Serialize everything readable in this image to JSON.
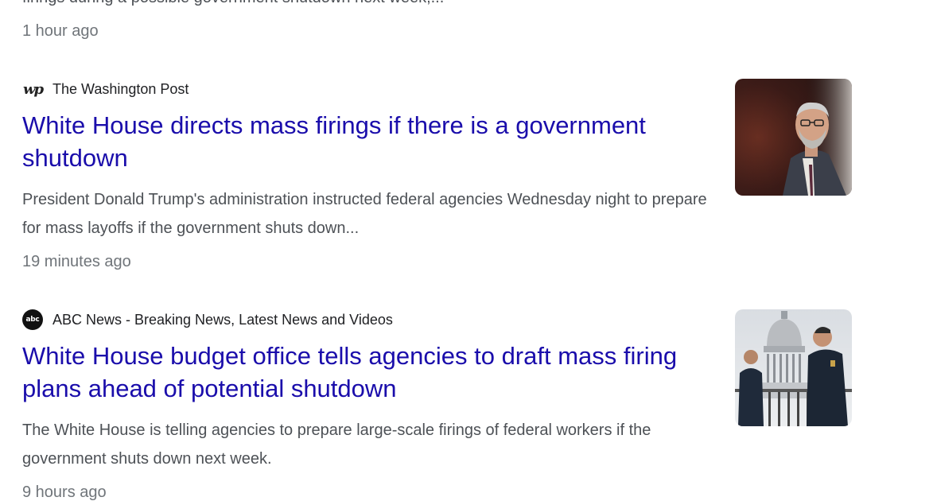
{
  "previous": {
    "snippet": "firings during a possible government shutdown next week,...",
    "time": "1 hour ago"
  },
  "articles": [
    {
      "source": "The Washington Post",
      "logo_text": "wp",
      "logo_icon": "washington-post-logo",
      "title": "White House directs mass firings if there is a government shutdown",
      "snippet": "President Donald Trump's administration instructed federal agencies Wednesday night to prepare for mass layoffs if the government shuts down...",
      "time": "19 minutes ago",
      "thumb_icon": "man-in-suit-photo"
    },
    {
      "source": "ABC News - Breaking News, Latest News and Videos",
      "logo_text": "abc",
      "logo_icon": "abc-news-logo",
      "title": "White House budget office tells agencies to draft mass firing plans ahead of potential shutdown",
      "snippet": "The White House is telling agencies to prepare large-scale firings of federal workers if the government shuts down next week.",
      "time": "9 hours ago",
      "thumb_icon": "capitol-police-photo"
    }
  ],
  "colors": {
    "headline": "#1a0dab",
    "snippet": "#4d5156",
    "time": "#70757a",
    "source": "#202124"
  }
}
